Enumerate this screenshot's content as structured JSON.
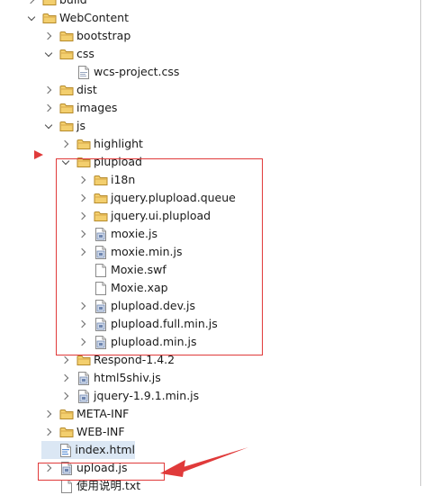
{
  "tree": {
    "items": [
      {
        "label": "build",
        "icon": "folder-icon"
      },
      {
        "label": "WebContent",
        "icon": "folder-icon"
      },
      {
        "label": "bootstrap",
        "icon": "folder-icon"
      },
      {
        "label": "css",
        "icon": "folder-icon"
      },
      {
        "label": "wcs-project.css",
        "icon": "css-file-icon"
      },
      {
        "label": "dist",
        "icon": "folder-icon"
      },
      {
        "label": "images",
        "icon": "folder-icon"
      },
      {
        "label": "js",
        "icon": "folder-icon"
      },
      {
        "label": "highlight",
        "icon": "folder-icon"
      },
      {
        "label": "plupload",
        "icon": "folder-icon"
      },
      {
        "label": "i18n",
        "icon": "folder-icon"
      },
      {
        "label": "jquery.plupload.queue",
        "icon": "folder-icon"
      },
      {
        "label": "jquery.ui.plupload",
        "icon": "folder-icon"
      },
      {
        "label": "moxie.js",
        "icon": "js-file-icon"
      },
      {
        "label": "moxie.min.js",
        "icon": "js-file-icon"
      },
      {
        "label": "Moxie.swf",
        "icon": "file-icon"
      },
      {
        "label": "Moxie.xap",
        "icon": "file-icon"
      },
      {
        "label": "plupload.dev.js",
        "icon": "js-file-icon"
      },
      {
        "label": "plupload.full.min.js",
        "icon": "js-file-icon"
      },
      {
        "label": "plupload.min.js",
        "icon": "js-file-icon"
      },
      {
        "label": "Respond-1.4.2",
        "icon": "folder-icon"
      },
      {
        "label": "html5shiv.js",
        "icon": "js-file-icon"
      },
      {
        "label": "jquery-1.9.1.min.js",
        "icon": "js-file-icon"
      },
      {
        "label": "META-INF",
        "icon": "folder-icon"
      },
      {
        "label": "WEB-INF",
        "icon": "folder-icon"
      },
      {
        "label": "index.html",
        "icon": "html-file-icon"
      },
      {
        "label": "upload.js",
        "icon": "js-file-icon"
      },
      {
        "label": "使用说明.txt",
        "icon": "text-file-icon"
      }
    ]
  },
  "colors": {
    "folder": "#e8b84a",
    "annotation": "#e03a3a",
    "selection": "#dbe7f4"
  }
}
